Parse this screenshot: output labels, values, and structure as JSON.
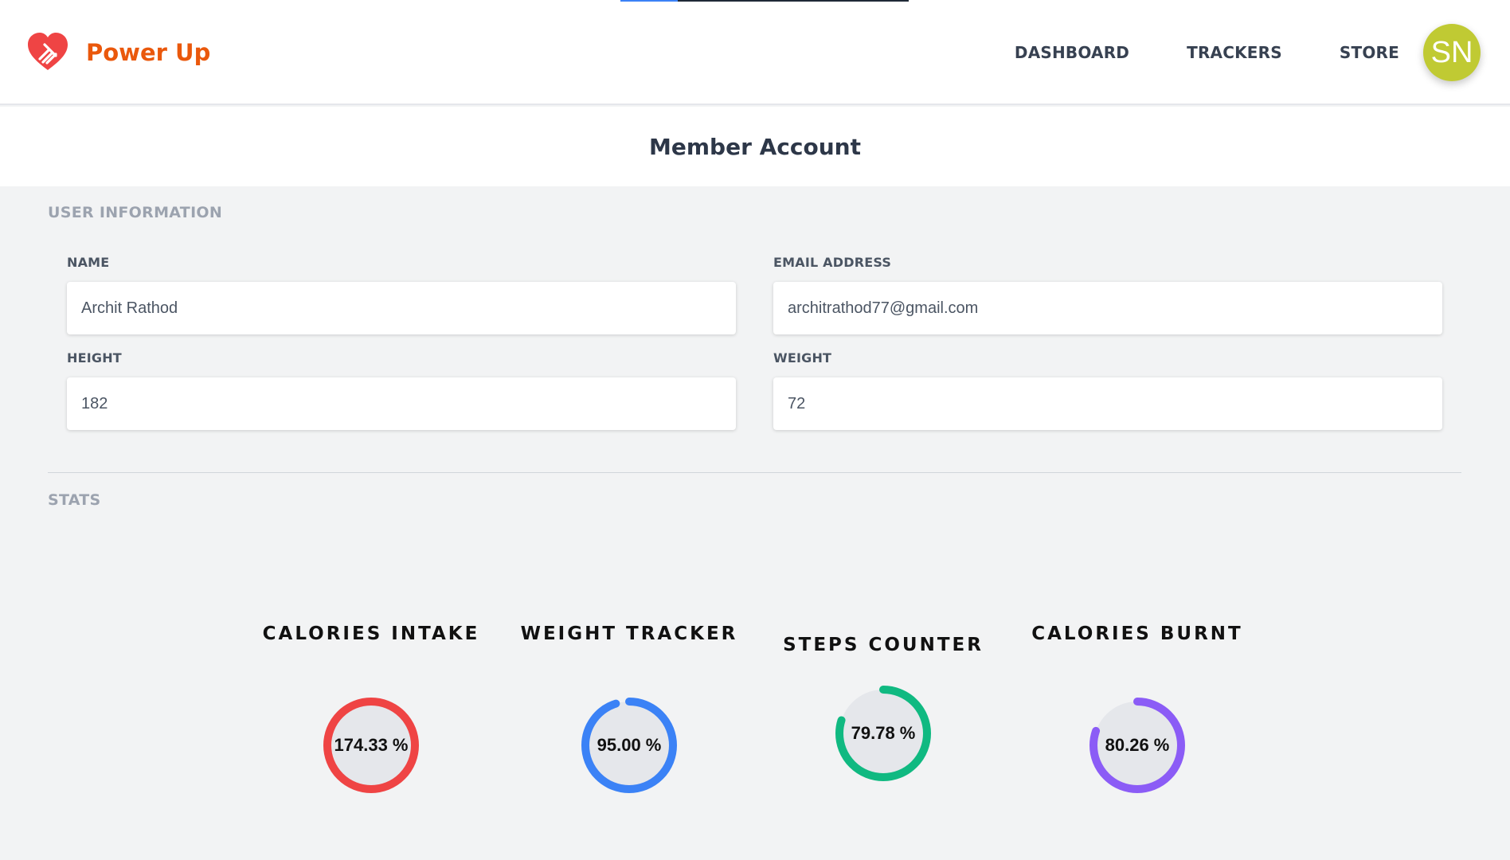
{
  "app": {
    "name": "Power Up",
    "logo_icon": "heart-icon",
    "brand_color": "#ea580c"
  },
  "page_load_progress": 0.2,
  "nav": {
    "items": [
      {
        "label": "DASHBOARD"
      },
      {
        "label": "TRACKERS"
      },
      {
        "label": "STORE"
      }
    ]
  },
  "user": {
    "initials": "SN",
    "avatar_color": "#c0ca33"
  },
  "page": {
    "title": "Member Account"
  },
  "user_info": {
    "heading": "USER INFORMATION",
    "name": {
      "label": "NAME",
      "value": "Archit Rathod"
    },
    "email": {
      "label": "EMAIL ADDRESS",
      "value": "architrathod77@gmail.com"
    },
    "height": {
      "label": "HEIGHT",
      "value": "182"
    },
    "weight": {
      "label": "WEIGHT",
      "value": "72"
    }
  },
  "stats": {
    "heading": "STATS",
    "items": [
      {
        "title": "CALORIES INTAKE",
        "value_text": "174.33 %",
        "percent": 174.33,
        "color": "#ef4444"
      },
      {
        "title": "WEIGHT TRACKER",
        "value_text": "95.00 %",
        "percent": 95.0,
        "color": "#3b82f6"
      },
      {
        "title": "STEPS COUNTER",
        "value_text": "79.78 %",
        "percent": 79.78,
        "color": "#10b981"
      },
      {
        "title": "CALORIES BURNT",
        "value_text": "80.26 %",
        "percent": 80.26,
        "color": "#8b5cf6"
      }
    ]
  }
}
